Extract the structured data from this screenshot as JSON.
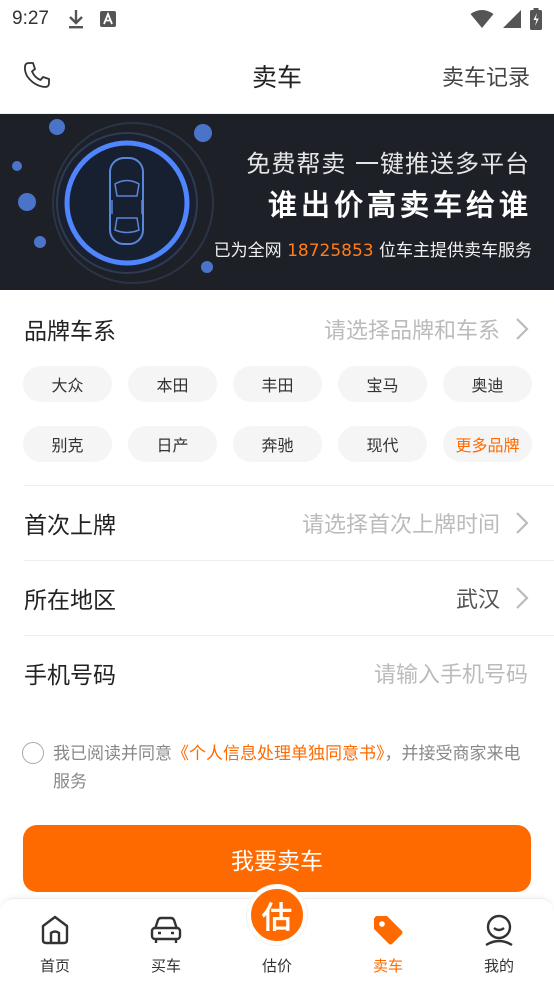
{
  "status_bar": {
    "time": "9:27"
  },
  "header": {
    "title": "卖车",
    "record_link": "卖车记录"
  },
  "banner": {
    "line1": "免费帮卖 一键推送多平台",
    "line2": "谁出价高卖车给谁",
    "line3_prefix": "已为全网 ",
    "line3_count": "18725853",
    "line3_suffix": " 位车主提供卖车服务"
  },
  "form": {
    "brand": {
      "label": "品牌车系",
      "placeholder": "请选择品牌和车系"
    },
    "brands": [
      "大众",
      "本田",
      "丰田",
      "宝马",
      "奥迪",
      "别克",
      "日产",
      "奔驰",
      "现代"
    ],
    "more_brands": "更多品牌",
    "first_reg": {
      "label": "首次上牌",
      "placeholder": "请选择首次上牌时间"
    },
    "region": {
      "label": "所在地区",
      "value": "武汉"
    },
    "phone": {
      "label": "手机号码",
      "placeholder": "请输入手机号码"
    }
  },
  "agreement": {
    "prefix": "我已阅读并同意",
    "link": "《个人信息处理单独同意书》",
    "suffix": "，并接受商家来电服务"
  },
  "submit_label": "我要卖车",
  "tabs": [
    {
      "label": "首页",
      "icon": "home-icon"
    },
    {
      "label": "买车",
      "icon": "car-icon"
    },
    {
      "label": "估价",
      "icon": "estimate-icon",
      "badge": "估"
    },
    {
      "label": "卖车",
      "icon": "tag-icon"
    },
    {
      "label": "我的",
      "icon": "user-icon"
    }
  ],
  "colors": {
    "accent": "#ff6a00",
    "banner_bg": "#1d2127",
    "banner_highlight": "#ff7d1a"
  }
}
